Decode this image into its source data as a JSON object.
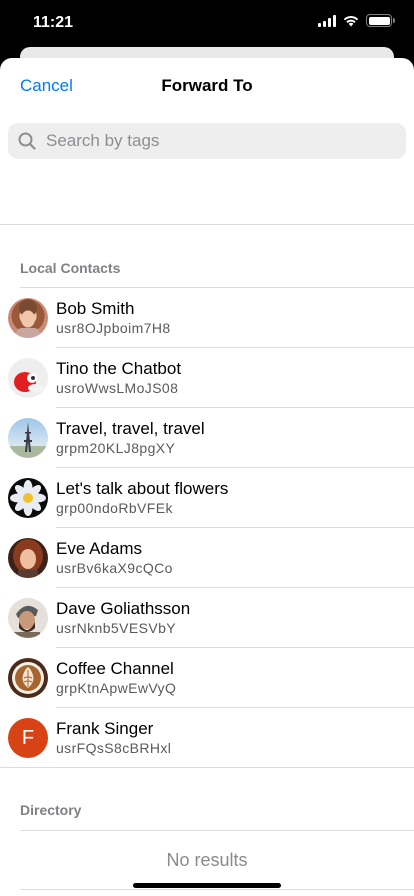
{
  "status_bar": {
    "time": "11:21"
  },
  "nav": {
    "cancel_label": "Cancel",
    "title": "Forward To"
  },
  "search": {
    "placeholder": "Search by tags"
  },
  "sections": {
    "local_header": "Local Contacts",
    "directory_header": "Directory",
    "directory_empty": "No results"
  },
  "contacts": [
    {
      "name": "Bob Smith",
      "id": "usr8OJpboim7H8",
      "avatar": "photo-curly-hair-man"
    },
    {
      "name": "Tino the Chatbot",
      "id": "usroWwsLMoJS08",
      "avatar": "photo-red-robot"
    },
    {
      "name": "Travel, travel, travel",
      "id": "grpm20KLJ8pgXY",
      "avatar": "photo-eiffel-tower"
    },
    {
      "name": "Let's talk about flowers",
      "id": "grp00ndoRbVFEk",
      "avatar": "photo-white-flower"
    },
    {
      "name": "Eve Adams",
      "id": "usrBv6kaX9cQCo",
      "avatar": "photo-red-hair-woman"
    },
    {
      "name": "Dave Goliathsson",
      "id": "usrNknb5VESVbY",
      "avatar": "photo-bearded-man"
    },
    {
      "name": "Coffee Channel",
      "id": "grpKtnApwEwVyQ",
      "avatar": "photo-latte-art"
    },
    {
      "name": "Frank Singer",
      "id": "usrFQsS8cBRHxl",
      "avatar": "letter",
      "letter": "F",
      "color": "#d84315"
    }
  ],
  "colors": {
    "accent": "#007aff",
    "separator": "#dcdcdf"
  }
}
